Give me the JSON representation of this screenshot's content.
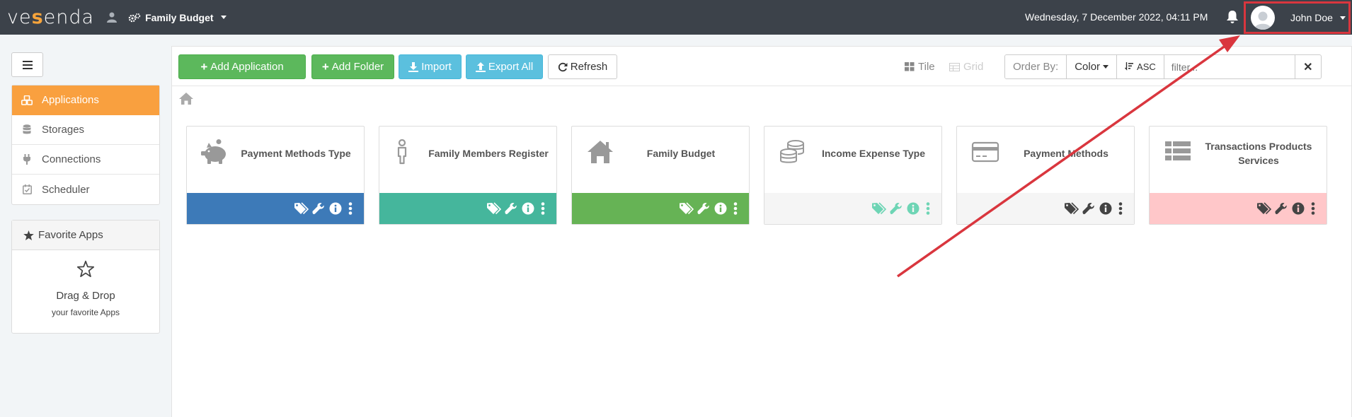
{
  "topbar": {
    "logo_pre": "ve",
    "logo_mid": "s",
    "logo_post": "enda",
    "app_name": "Family Budget",
    "datetime": "Wednesday, 7 December 2022, 04:11 PM",
    "user_name": "John Doe"
  },
  "sidebar": {
    "items": [
      {
        "label": "Applications",
        "icon": "cubes-icon",
        "active": true
      },
      {
        "label": "Storages",
        "icon": "database-icon",
        "active": false
      },
      {
        "label": "Connections",
        "icon": "plug-icon",
        "active": false
      },
      {
        "label": "Scheduler",
        "icon": "calendar-check-icon",
        "active": false
      }
    ],
    "favorites": {
      "title": "Favorite Apps",
      "line1": "Drag & Drop",
      "line2": "your favorite Apps"
    }
  },
  "toolbar": {
    "add_application": "Add Application",
    "add_folder": "Add Folder",
    "import": "Import",
    "export_all": "Export All",
    "refresh": "Refresh",
    "tile": "Tile",
    "grid": "Grid",
    "order_by": "Order By:",
    "order_value": "Color",
    "sort_dir": "ASC",
    "filter_placeholder": "filter...",
    "clear": "✕"
  },
  "tiles": [
    {
      "name": "Payment Methods Type",
      "icon": "piggy-bank-icon",
      "bar_color": "#3d7ab8",
      "icon_color": "#ffffff"
    },
    {
      "name": "Family Members Register",
      "icon": "person-icon",
      "bar_color": "#45b69c",
      "icon_color": "#ffffff"
    },
    {
      "name": "Family Budget",
      "icon": "home-icon",
      "bar_color": "#66b355",
      "icon_color": "#ffffff"
    },
    {
      "name": "Income Expense Type",
      "icon": "coins-icon",
      "bar_color": "#f5f5f5",
      "icon_color": "#6ed5b5"
    },
    {
      "name": "Payment Methods",
      "icon": "credit-card-icon",
      "bar_color": "#f5f5f5",
      "icon_color": "#444444"
    },
    {
      "name": "Transactions Products Services",
      "icon": "list-icon",
      "bar_color": "#ffc7c9",
      "icon_color": "#444444"
    }
  ]
}
